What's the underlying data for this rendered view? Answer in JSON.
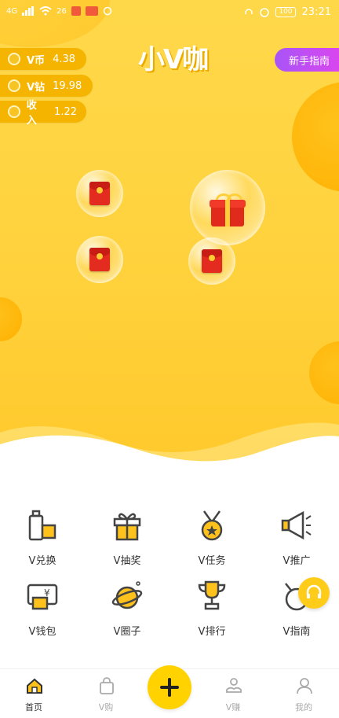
{
  "status_bar": {
    "network": "4G",
    "speed": "26",
    "time": "23:21",
    "battery": "100"
  },
  "wallet": {
    "coin_label": "V币",
    "coin_value": "4.38",
    "diamond_label": "V钻",
    "diamond_value": "19.98",
    "income_label": "收入",
    "income_value": "1.22"
  },
  "header": {
    "logo_text": "小V咖",
    "guide_button": "新手指南"
  },
  "bubbles": {
    "items": [
      "red-envelope",
      "gift-box",
      "red-envelope",
      "red-envelope"
    ]
  },
  "features": {
    "items": [
      {
        "label": "V兑换",
        "icon": "exchange-icon"
      },
      {
        "label": "V抽奖",
        "icon": "gift-icon"
      },
      {
        "label": "V任务",
        "icon": "medal-icon"
      },
      {
        "label": "V推广",
        "icon": "megaphone-icon"
      },
      {
        "label": "V钱包",
        "icon": "wallet-icon"
      },
      {
        "label": "V圈子",
        "icon": "planet-icon"
      },
      {
        "label": "V排行",
        "icon": "trophy-icon"
      },
      {
        "label": "V指南",
        "icon": "guide-icon"
      }
    ]
  },
  "tabbar": {
    "items": [
      {
        "label": "首页",
        "icon": "home-icon"
      },
      {
        "label": "V购",
        "icon": "shopping-bag-icon"
      },
      {
        "label": "",
        "icon": "plus-icon"
      },
      {
        "label": "V赚",
        "icon": "earn-icon"
      },
      {
        "label": "我的",
        "icon": "profile-icon"
      }
    ]
  },
  "colors": {
    "brand_yellow": "#ffd23d",
    "accent_orange": "#f5b400",
    "guide_purple": "#b84ef2",
    "envelope_red": "#e32b1f"
  }
}
